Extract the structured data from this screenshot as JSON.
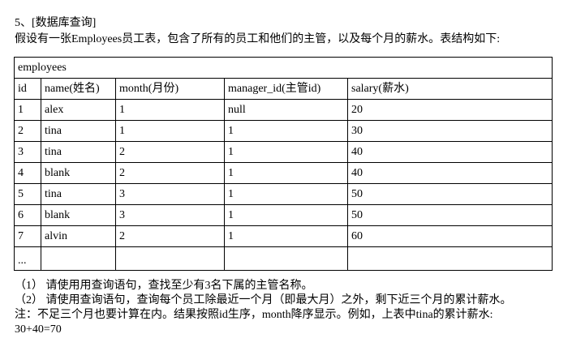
{
  "heading": "5、[数据库查询]",
  "intro": "假设有一张Employees员工表，包含了所有的员工和他们的主管，以及每个月的薪水。表结构如下:",
  "table": {
    "name": "employees",
    "headers": [
      "id",
      "name(姓名)",
      "month(月份)",
      "manager_id(主管id)",
      "salary(薪水)"
    ],
    "rows": [
      [
        "1",
        "alex",
        "1",
        "null",
        "20"
      ],
      [
        "2",
        "tina",
        "1",
        "1",
        "30"
      ],
      [
        "3",
        "tina",
        "2",
        "1",
        "40"
      ],
      [
        "4",
        "blank",
        "2",
        "1",
        "40"
      ],
      [
        "5",
        "tina",
        "3",
        "1",
        "50"
      ],
      [
        "6",
        "blank",
        "3",
        "1",
        "50"
      ],
      [
        "7",
        "alvin",
        "2",
        "1",
        "60"
      ]
    ],
    "ellipsis_row": [
      "...",
      "",
      "",
      "",
      ""
    ]
  },
  "questions": [
    "（1） 请使用用查询语句，查找至少有3名下属的主管名称。",
    "（2） 请使用查询语句，查询每个员工除最近一个月（即最大月）之外，剩下近三个月的累计薪水。"
  ],
  "note": "注：不足三个月也要计算在内。结果按照id生序，month降序显示。例如，上表中tina的累计薪水:",
  "formula": "30+40=70"
}
